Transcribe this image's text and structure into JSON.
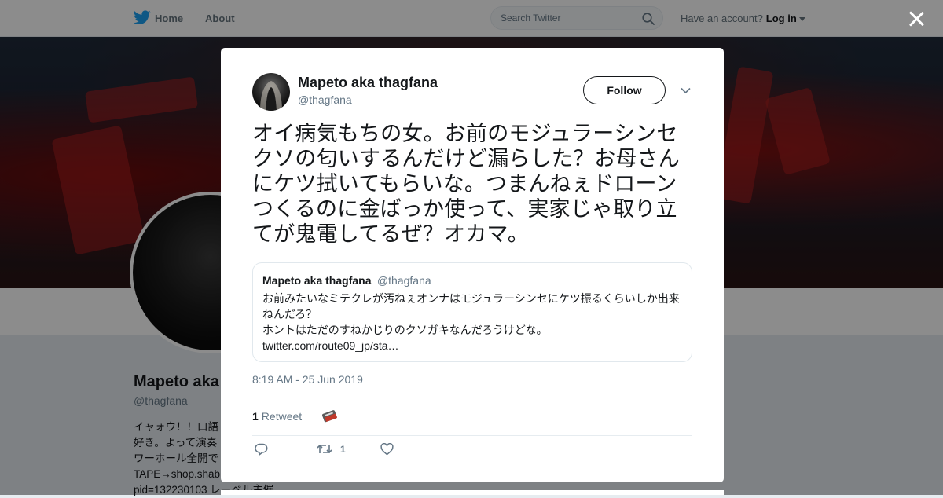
{
  "topbar": {
    "home_label": "Home",
    "about_label": "About",
    "search_placeholder": "Search Twitter",
    "have_account": "Have an account?",
    "login_label": "Log in"
  },
  "profile": {
    "name": "Mapeto aka",
    "handle": "@thagfana",
    "bio_lines": [
      "イャォウ！！口語",
      "好き。よって演奏",
      "ワーホール全開で",
      "TAPE→shop.shab",
      "pid=132230103 レーベル主催"
    ]
  },
  "tweet": {
    "author_name": "Mapeto aka thagfana",
    "author_handle": "@thagfana",
    "follow_label": "Follow",
    "text": "オイ病気もちの女。お前のモジュラーシンセクソの匂いするんだけど漏らした？お母さんにケツ拭いてもらいな。つまんねぇドローンつくるのに金ばっか使って、実家じゃ取り立てが鬼電してるぜ？オカマ。",
    "quoted": {
      "name": "Mapeto aka thagfana",
      "handle": "@thagfana",
      "line1": "お前みたいなミテクレが汚ねぇオンナはモジュラーシンセにケツ振るくらいしか出来ねんだろ？",
      "line2": "ホントはただのすねかじりのクソガキなんだろうけどな。",
      "link": "twitter.com/route09_jp/sta…"
    },
    "timestamp": "8:19 AM - 25 Jun 2019",
    "retweet_count": "1",
    "retweet_label": "Retweet",
    "action_retweet_count": "1"
  },
  "colors": {
    "twitter_blue": "#1da1f2",
    "secondary_text": "#657786"
  },
  "icons": [
    "twitter-bird-icon",
    "search-icon",
    "close-icon",
    "chevron-down-icon",
    "reply-icon",
    "retweet-icon",
    "heart-icon"
  ]
}
